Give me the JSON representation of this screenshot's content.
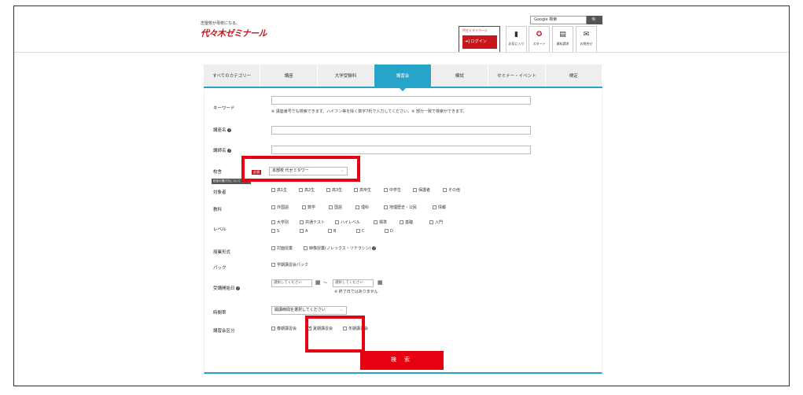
{
  "header": {
    "tagline": "志望校が母校になる。",
    "logo_text": "代々木ゼミナール",
    "google_search_label": "Google 検索",
    "google_search_button": "🔍",
    "mypage_label": "代ゼミマイページ",
    "login_label": "➜] ログイン",
    "icons": [
      {
        "name": "bookmark-icon",
        "glyph": "▮",
        "label": "お気に入り"
      },
      {
        "name": "badge-icon",
        "glyph": "✪",
        "label": "スタート"
      },
      {
        "name": "document-icon",
        "glyph": "▤",
        "label": "資料請求"
      },
      {
        "name": "mail-icon",
        "glyph": "✉",
        "label": "お問合せ"
      }
    ]
  },
  "tabs": [
    {
      "label": "すべてのカテゴリー",
      "active": false
    },
    {
      "label": "講座",
      "active": false
    },
    {
      "label": "大学受験科",
      "active": false
    },
    {
      "label": "講習会",
      "active": true
    },
    {
      "label": "模試",
      "active": false
    },
    {
      "label": "セミナー・イベント",
      "active": false
    },
    {
      "label": "検定",
      "active": false
    }
  ],
  "form": {
    "keyword_label": "キーワード",
    "keyword_note": "※ 講座番号でも検索できます。ハイフン等を除く数字7桁で入力してください。※ 部分一致で検索ができます。",
    "course_name_label": "講座名",
    "lecturer_label": "講師名",
    "school_label": "校舎",
    "required_badge": "必須",
    "school_value": "本部校 代ゼミタワー",
    "school_help": "校舎の選び方について",
    "target_label": "対象者",
    "target_options": [
      "高1生",
      "高2生",
      "高3生",
      "高卒生",
      "中学生",
      "保護者",
      "その他"
    ],
    "subject_label": "教科",
    "subject_options": [
      "外国語",
      "数学",
      "国語",
      "理科",
      "地理歴史・公民",
      "情報"
    ],
    "level_label": "レベル",
    "level_options_row1": [
      "大学別",
      "共通テスト",
      "ハイレベル",
      "標準",
      "基礎",
      "入門"
    ],
    "level_options_row2": [
      "S",
      "A",
      "B",
      "C",
      "D"
    ],
    "format_label": "授業形式",
    "format_options": [
      "対面授業",
      "映像授業(ノレックス・リテラシン)"
    ],
    "pack_label": "パック",
    "pack_option": "学期講習会パック",
    "start_date_label": "受講開始日",
    "date_placeholder": "選択してください",
    "date_sep": "〜",
    "date_note": "※ 終了日ではありません",
    "time_label": "時間帯",
    "time_value": "開講時間を選択してください",
    "session_label": "講習会区分",
    "session_options": [
      {
        "label": "春期講習会",
        "checked": false
      },
      {
        "label": "夏期講習会",
        "checked": true
      },
      {
        "label": "冬期講習会",
        "checked": false
      }
    ],
    "search_button": "検 索"
  }
}
